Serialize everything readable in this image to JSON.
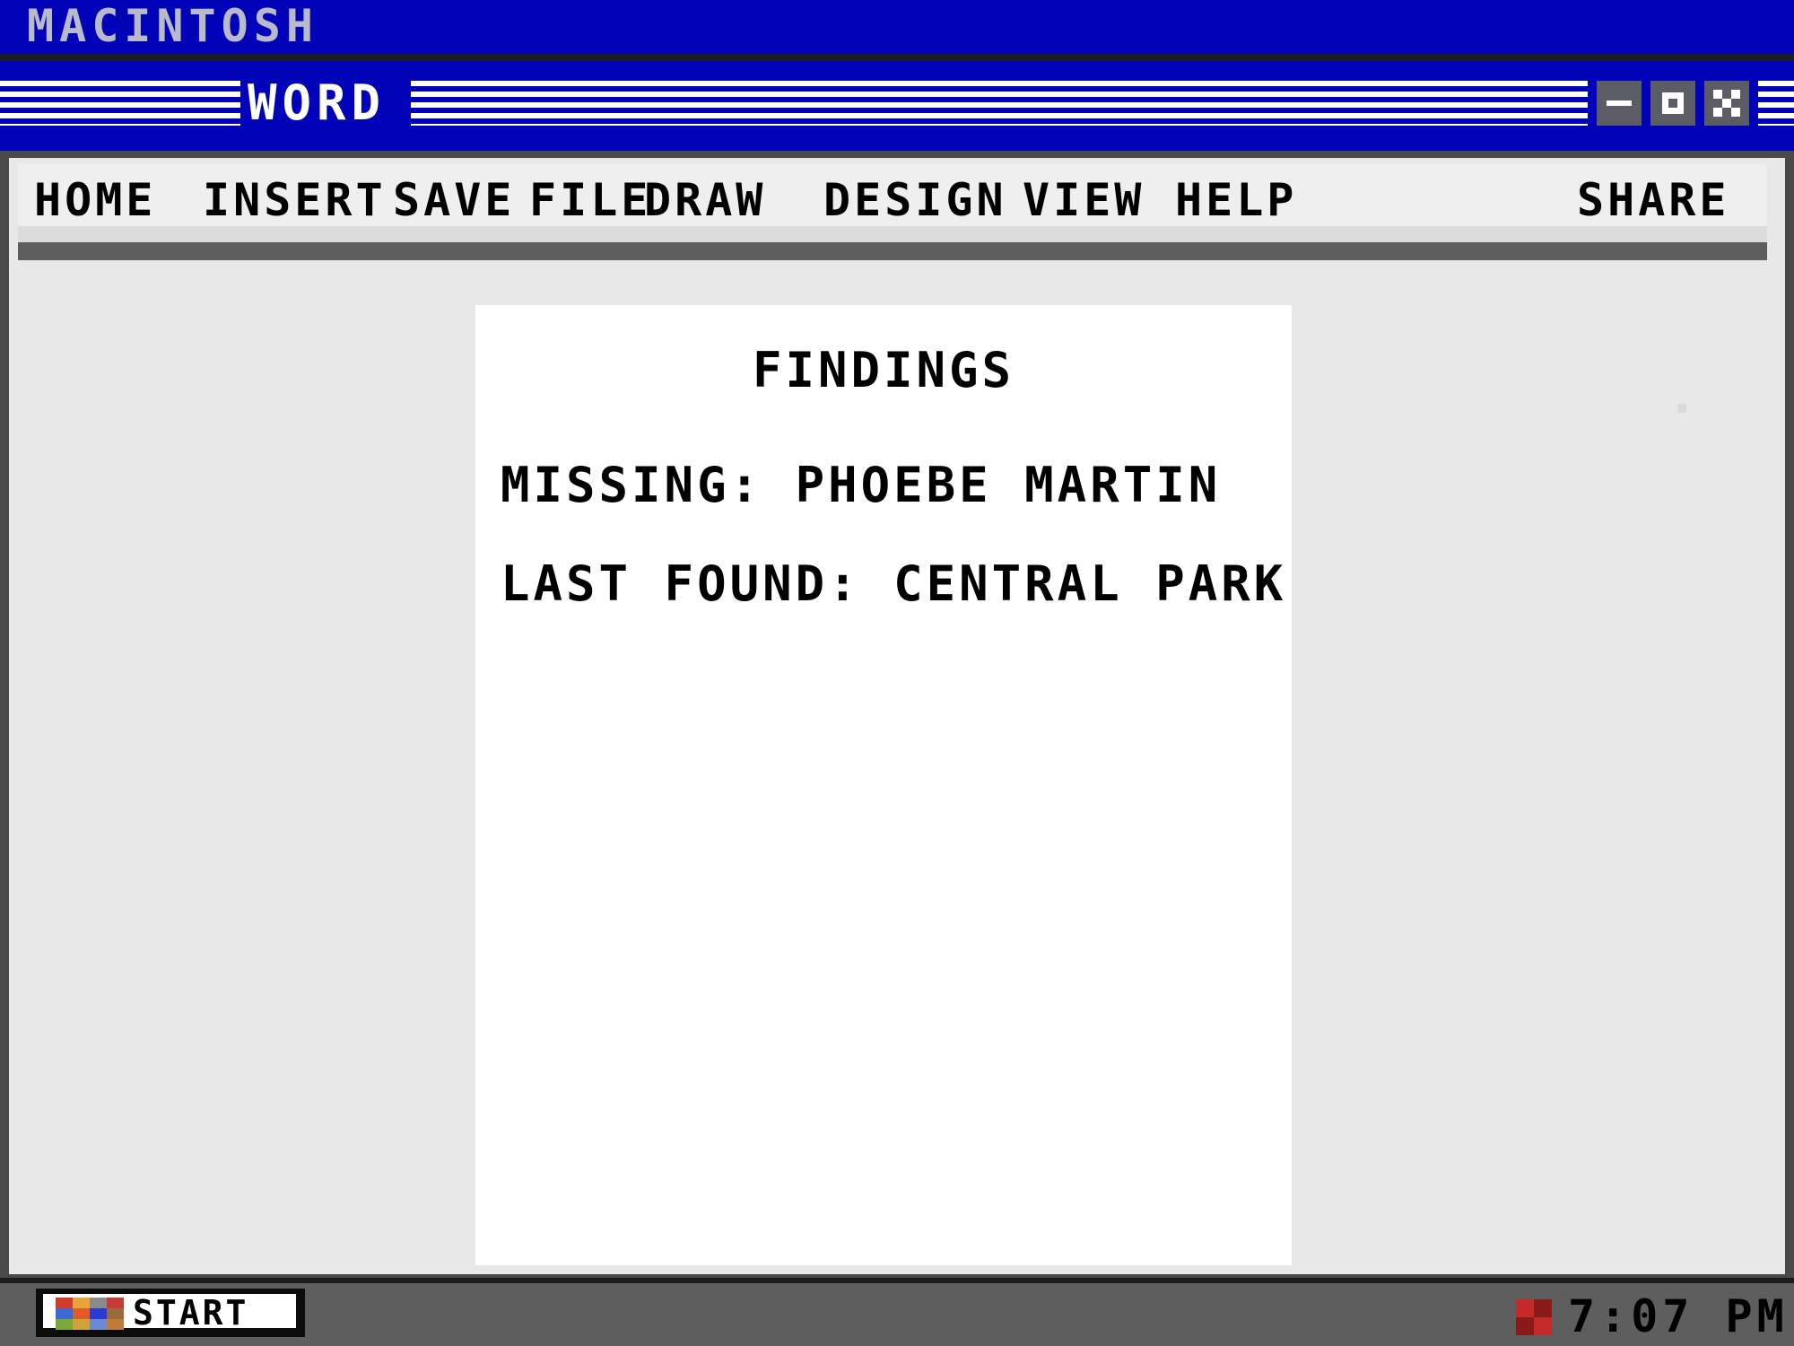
{
  "system_bar": {
    "title": "MACINTOSH"
  },
  "window": {
    "title": "WORD",
    "controls": [
      "minimize",
      "maximize",
      "close"
    ]
  },
  "menu": {
    "items": [
      "HOME",
      "INSERT",
      "SAVE",
      "FILE",
      "DRAW",
      "DESIGN",
      "VIEW",
      "HELP"
    ],
    "share_label": "SHARE"
  },
  "document": {
    "title": "FINDINGS",
    "lines": [
      "MISSING: PHOEBE MARTIN",
      "LAST FOUND: CENTRAL PARK"
    ]
  },
  "taskbar": {
    "start_label": "START",
    "clock": "7:07 PM"
  },
  "colors": {
    "title_bar": "#0202b8",
    "window_body": "#e8e8e8",
    "page": "#ffffff",
    "taskbar": "#5e5e5e"
  }
}
